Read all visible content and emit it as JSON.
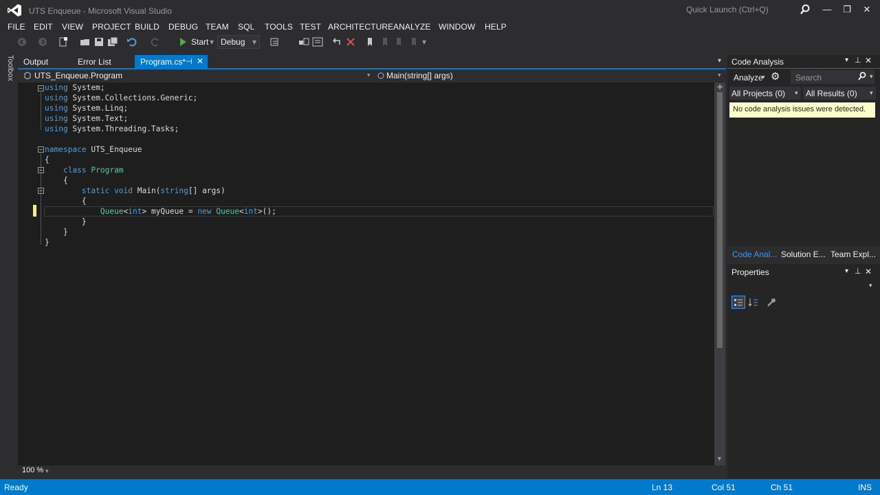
{
  "window": {
    "title": "UTS Enqueue - Microsoft Visual Studio",
    "quick_launch_placeholder": "Quick Launch (Ctrl+Q)"
  },
  "menu": [
    "FILE",
    "EDIT",
    "VIEW",
    "PROJECT",
    "BUILD",
    "DEBUG",
    "TEAM",
    "SQL",
    "TOOLS",
    "TEST",
    "ARCHITECTURE",
    "ANALYZE",
    "WINDOW",
    "HELP"
  ],
  "toolbar": {
    "start_label": "Start",
    "config_value": "Debug"
  },
  "toolbox_label": "Toolbox",
  "tabs": [
    {
      "label": "Output",
      "active": false
    },
    {
      "label": "Error List",
      "active": false
    },
    {
      "label": "Program.cs*",
      "active": true
    }
  ],
  "nav": {
    "class_scope": "UTS_Enqueue.Program",
    "member_scope": "Main(string[] args)"
  },
  "code": {
    "line1": [
      "using",
      " System;"
    ],
    "line2": [
      "using",
      " System.Collections.Generic;"
    ],
    "line3": [
      "using",
      " System.Linq;"
    ],
    "line4": [
      "using",
      " System.Text;"
    ],
    "line5": [
      "using",
      " System.Threading.Tasks;"
    ],
    "line7": [
      "namespace",
      " UTS_Enqueue"
    ],
    "line8": "{",
    "line9": [
      "    ",
      "class",
      " ",
      "Program"
    ],
    "line10": "    {",
    "line11": [
      "        ",
      "static",
      " ",
      "void",
      " Main(",
      "string",
      "[] args)"
    ],
    "line12": "        {",
    "line13": [
      "            ",
      "Queue",
      "<",
      "int",
      "> myQueue = ",
      "new",
      " ",
      "Queue",
      "<",
      "int",
      ">();"
    ],
    "line14": "        }",
    "line15": "    }",
    "line16": "}"
  },
  "zoom": "100 %",
  "code_analysis": {
    "title": "Code Analysis",
    "analyze_label": "Analyze",
    "search_placeholder": "Search",
    "projects_filter": "All Projects (0)",
    "results_filter": "All Results (0)",
    "notice": "No code analysis issues were detected."
  },
  "panel_tabs": [
    {
      "label": "Code Anal...",
      "active": true
    },
    {
      "label": "Solution E...",
      "active": false
    },
    {
      "label": "Team Expl...",
      "active": false
    }
  ],
  "properties": {
    "title": "Properties"
  },
  "status": {
    "ready": "Ready",
    "line": "Ln 13",
    "col": "Col 51",
    "ch": "Ch 51",
    "mode": "INS"
  },
  "colors": {
    "accent": "#007acc",
    "keyword": "#569cd6",
    "type": "#4ec9b0",
    "editor_bg": "#1e1e1e",
    "notice_bg": "#fefecb"
  }
}
